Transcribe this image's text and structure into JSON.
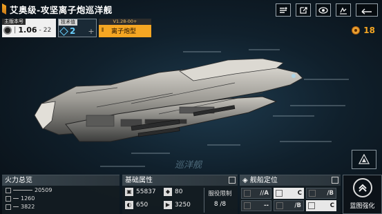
{
  "header": {
    "title": "艾奥级-攻坚离子炮巡洋舰",
    "icons": [
      "filter-icon",
      "share-icon",
      "view-icon",
      "lock-icon",
      "back-icon"
    ]
  },
  "info": {
    "version_label": "主版本号",
    "version_main": "1.06",
    "version_sub": "22",
    "tech_label": "技术值",
    "tech_value": "2",
    "type_top": "V1.28-00+",
    "type_label": "离子炮型"
  },
  "currency": {
    "value": "18",
    "icon": "coin-icon"
  },
  "watermark": "巡洋舰",
  "fire_panel": {
    "title": "火力总览",
    "rows": [
      {
        "value": "20509"
      },
      {
        "value": "1260"
      },
      {
        "value": "3822"
      }
    ]
  },
  "attr_panel": {
    "title": "基础属性",
    "cells": [
      {
        "value": "55837",
        "icon": "hull-icon"
      },
      {
        "value": "80",
        "icon": "armor-icon"
      },
      {
        "value": "650",
        "icon": "shield-icon"
      },
      {
        "value": "3250",
        "icon": "speed-icon"
      }
    ],
    "limit_label": "服役限制",
    "limit_value": "8 /8"
  },
  "pos_panel": {
    "title": "舰船定位",
    "cells": [
      {
        "grade": "A",
        "prefix": "//",
        "style": "dark"
      },
      {
        "grade": "C",
        "prefix": "",
        "style": "light"
      },
      {
        "grade": "B",
        "prefix": "/",
        "style": "dark"
      },
      {
        "grade": "--",
        "prefix": "",
        "style": "dark"
      },
      {
        "grade": "B",
        "prefix": "/",
        "style": "dark"
      },
      {
        "grade": "C",
        "prefix": "",
        "style": "light"
      }
    ]
  },
  "blueprint": {
    "label": "蓝图强化"
  },
  "colors": {
    "accent": "#f5a623",
    "tech": "#6ad0ff",
    "panel": "#141c22"
  }
}
